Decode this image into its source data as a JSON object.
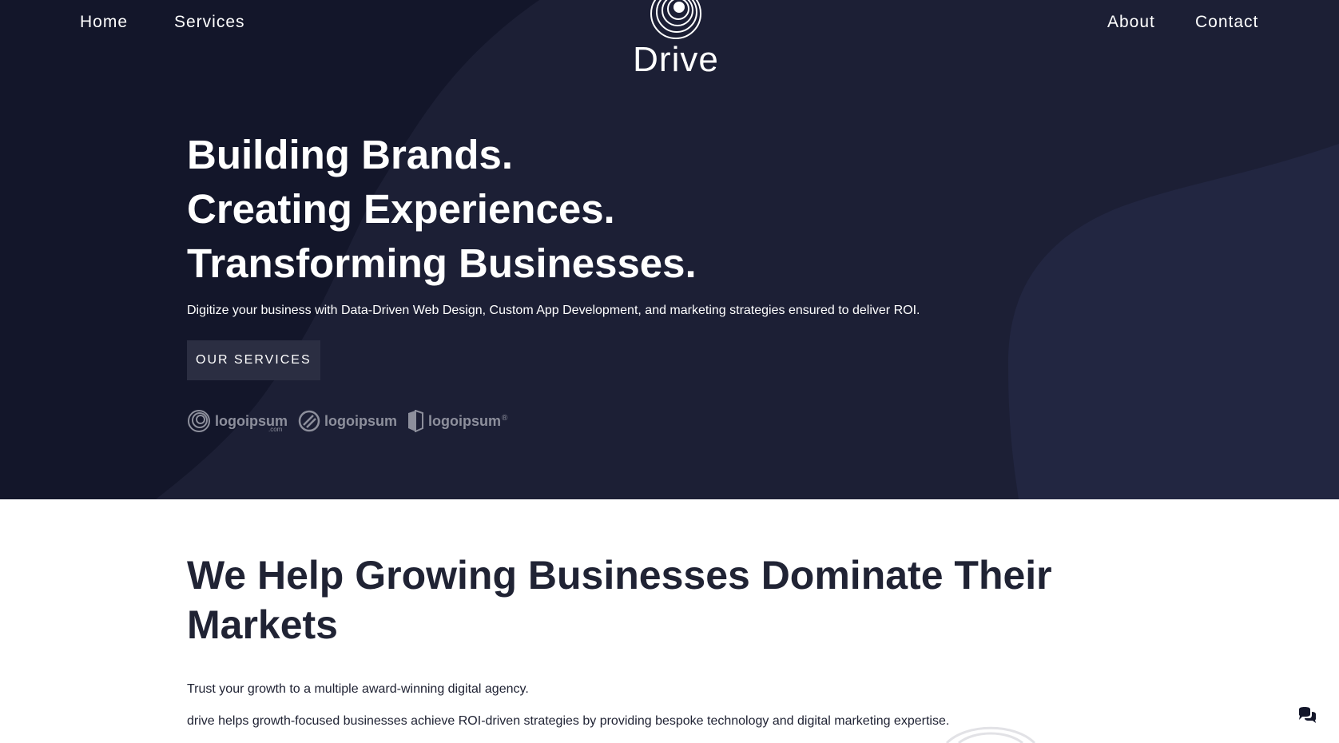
{
  "nav": {
    "home": "Home",
    "services": "Services",
    "about": "About",
    "contact": "Contact"
  },
  "brand": {
    "name": "Drive",
    "icon": "concentric-circles-logo-icon"
  },
  "hero": {
    "headline_lines": [
      "Building Brands.",
      "Creating Experiences.",
      "Transforming Businesses."
    ],
    "subheading": "Digitize your business with Data-Driven Web Design, Custom App Development, and marketing strategies ensured to deliver ROI.",
    "cta_label": "OUR SERVICES",
    "partner_logos": [
      {
        "text": "logoipsum",
        "suffix": ".com",
        "icon": "spiral-logo-icon"
      },
      {
        "text": "logoipsum",
        "icon": "slashed-circle-logo-icon"
      },
      {
        "text": "logoipsum",
        "suffix": "®",
        "icon": "half-shield-logo-icon"
      }
    ]
  },
  "section": {
    "title": "We Help Growing Businesses Dominate Their Markets",
    "paragraphs": [
      "Trust your growth to a multiple award-winning digital agency.",
      "drive helps growth-focused businesses achieve ROI-driven strategies by providing bespoke technology and digital marketing expertise."
    ]
  },
  "chat": {
    "icon": "chat-bubbles-icon"
  },
  "colors": {
    "hero_bg": "#13162a",
    "hero_shape": "#1c1f35",
    "hero_shape_right": "#222641",
    "cta_bg": "#2b2e42",
    "text_dark": "#202334",
    "logo_gray": "#8d8f9c"
  }
}
